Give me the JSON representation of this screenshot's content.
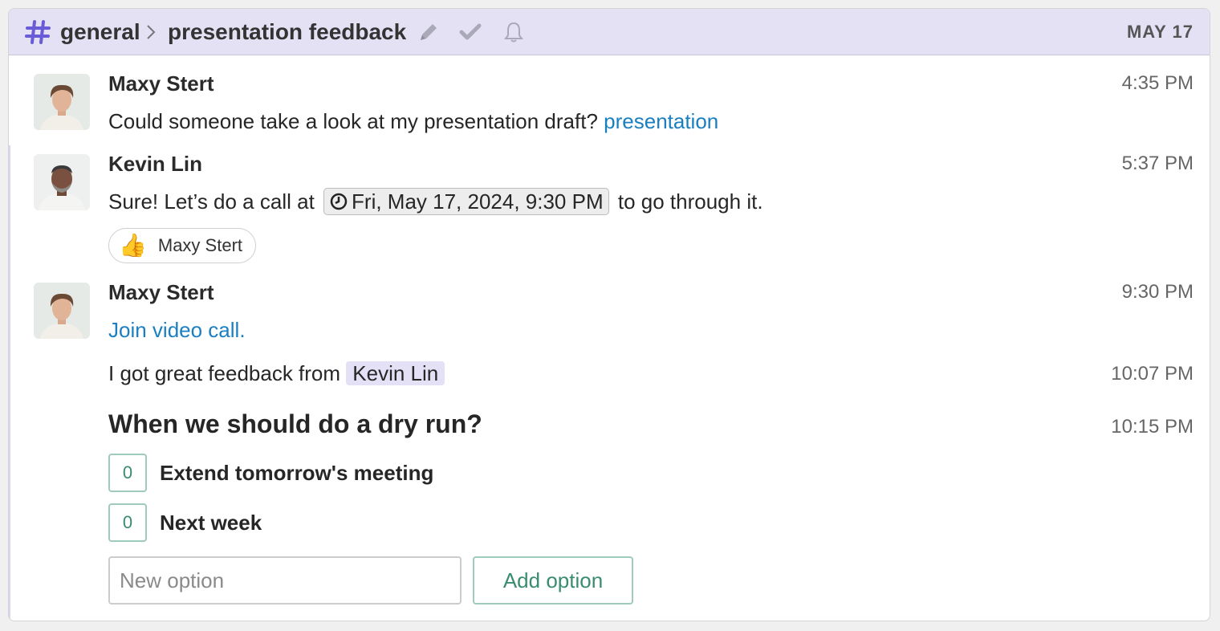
{
  "header": {
    "stream": "general",
    "topic": "presentation feedback",
    "date": "MAY 17",
    "hash_icon": "hash-icon",
    "icons": [
      "pencil-icon",
      "check-icon",
      "bell-icon"
    ]
  },
  "messages": [
    {
      "sender": "Maxy Stert",
      "time": "4:35 PM",
      "text": "Could someone take a look at my presentation draft?",
      "link": "presentation"
    },
    {
      "sender": "Kevin Lin",
      "time": "5:37 PM",
      "text_before": "Sure! Let’s do a call at",
      "timestamp": "Fri, May 17, 2024, 9:30 PM",
      "text_after": "to go through it.",
      "reaction": {
        "emoji": "👍",
        "user": "Maxy Stert"
      }
    },
    {
      "sender": "Maxy Stert",
      "time": "9:30 PM",
      "link": "Join video call."
    },
    {
      "time": "10:07 PM",
      "text": "I got great feedback from",
      "mention": "Kevin Lin"
    },
    {
      "time": "10:15 PM",
      "poll": {
        "question": "When we should do a dry run?",
        "options": [
          {
            "votes": "0",
            "label": "Extend tomorrow's meeting"
          },
          {
            "votes": "0",
            "label": "Next week"
          }
        ],
        "new_option_placeholder": "New option",
        "add_option_label": "Add option"
      }
    }
  ],
  "colors": {
    "header_bg": "#e4e1f5",
    "accent": "#6a5bd6",
    "link": "#1a7fc1",
    "poll_green": "#3a8c6e",
    "mention_bg": "#e4e1f7"
  }
}
